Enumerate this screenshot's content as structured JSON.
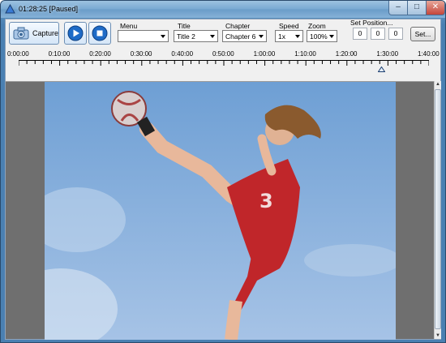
{
  "window": {
    "title": "01:28:25 [Paused]",
    "controls": {
      "minimize": "–",
      "maximize": "□",
      "close": "✕"
    }
  },
  "toolbar": {
    "capture_label": "Capture",
    "play_icon": "play-icon",
    "stop_icon": "stop-icon",
    "menu": {
      "label": "Menu",
      "value": ""
    },
    "title": {
      "label": "Title",
      "value": "Title 2"
    },
    "chapter": {
      "label": "Chapter",
      "value": "Chapter 6"
    },
    "speed": {
      "label": "Speed",
      "value": "1x"
    },
    "zoom": {
      "label": "Zoom",
      "value": "100%"
    },
    "set_position": {
      "label": "Set Position...",
      "h": "0",
      "m": "0",
      "s": "0",
      "button": "Set..."
    }
  },
  "timeline": {
    "labels": [
      "0:00:00",
      "0:10:00",
      "0:20:00",
      "0:30:00",
      "0:40:00",
      "0:50:00",
      "1:00:00",
      "1:10:00",
      "1:20:00",
      "1:30:00",
      "1:40:00"
    ],
    "position_fraction": 0.884
  },
  "colors": {
    "accent": "#1e6bc7",
    "video_bg": "#6f6f6f",
    "sky": "#7ea9d8",
    "jersey": "#c0262a"
  }
}
